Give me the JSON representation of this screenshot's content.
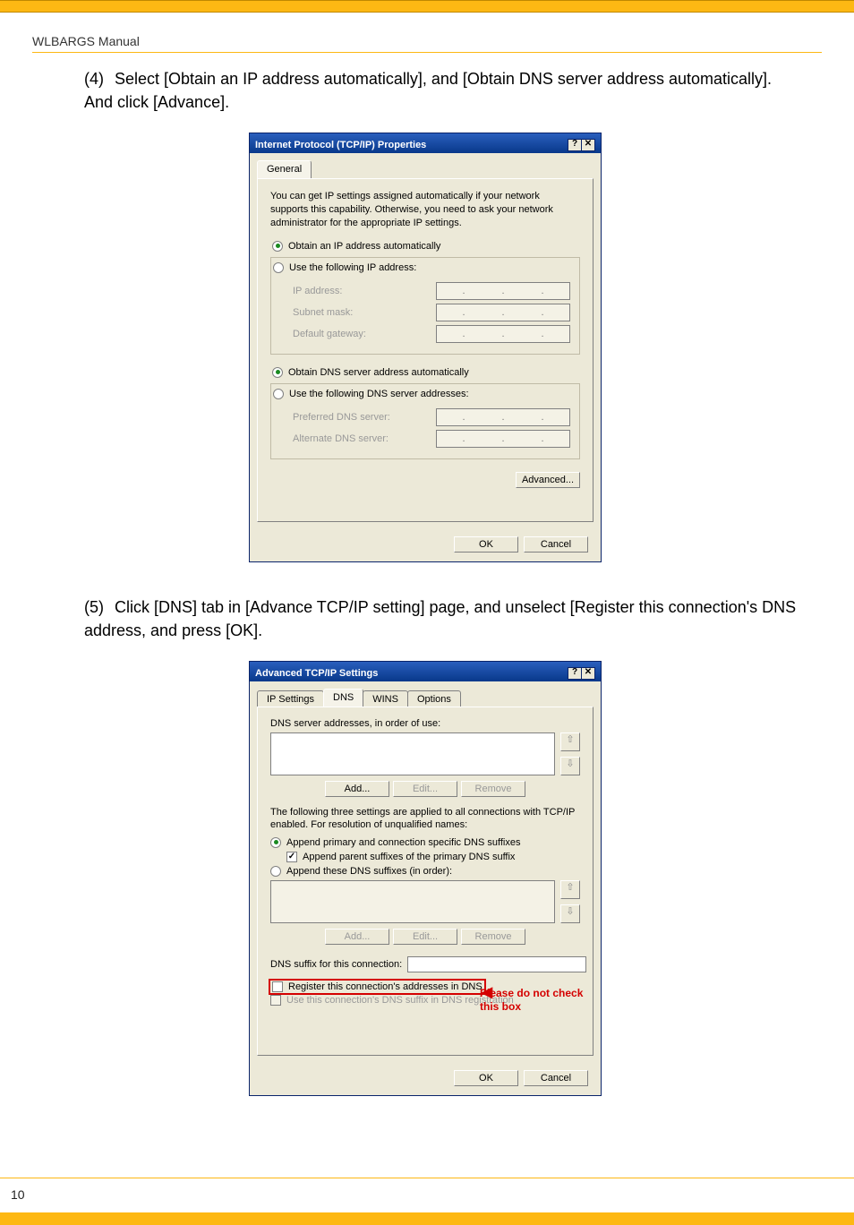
{
  "doc": {
    "header": "WLBARGS Manual",
    "page_number": "10"
  },
  "instr4": {
    "num": "(4)",
    "text": "Select [Obtain an IP address automatically], and [Obtain DNS server address automatically]. And click [Advance]."
  },
  "instr5": {
    "num": "(5)",
    "text": "Click [DNS] tab in [Advance TCP/IP setting] page, and unselect [Register this connection's DNS address, and press [OK]."
  },
  "dlg1": {
    "title": "Internet Protocol (TCP/IP) Properties",
    "tab_general": "General",
    "hint": "You can get IP settings assigned automatically if your network supports this capability. Otherwise, you need to ask your network administrator for the appropriate IP settings.",
    "r_auto_ip": "Obtain an IP address automatically",
    "r_use_ip": "Use the following IP address:",
    "l_ip": "IP address:",
    "l_mask": "Subnet mask:",
    "l_gw": "Default gateway:",
    "r_auto_dns": "Obtain DNS server address automatically",
    "r_use_dns": "Use the following DNS server addresses:",
    "l_pref": "Preferred DNS server:",
    "l_alt": "Alternate DNS server:",
    "btn_adv": "Advanced...",
    "btn_ok": "OK",
    "btn_cancel": "Cancel",
    "tb_help": "?",
    "tb_close": "✕"
  },
  "dlg2": {
    "title": "Advanced TCP/IP Settings",
    "tabs": {
      "ip": "IP Settings",
      "dns": "DNS",
      "wins": "WINS",
      "options": "Options"
    },
    "l_list1": "DNS server addresses, in order of use:",
    "btn_add": "Add...",
    "btn_edit": "Edit...",
    "btn_remove": "Remove",
    "mid_text": "The following three settings are applied to all connections with TCP/IP enabled. For resolution of unqualified names:",
    "r_append_primary": "Append primary and connection specific DNS suffixes",
    "c_append_parent": "Append parent suffixes of the primary DNS suffix",
    "r_append_these": "Append these DNS suffixes (in order):",
    "l_suffix": "DNS suffix for this connection:",
    "c_register": "Register this connection's addresses in DNS",
    "c_use_suffix": "Use this connection's DNS suffix in DNS registration",
    "btn_ok": "OK",
    "btn_cancel": "Cancel",
    "tb_help": "?",
    "tb_close": "✕",
    "arrow_up": "⇧",
    "arrow_dn": "⇩",
    "annot": "Please do not check this box"
  }
}
